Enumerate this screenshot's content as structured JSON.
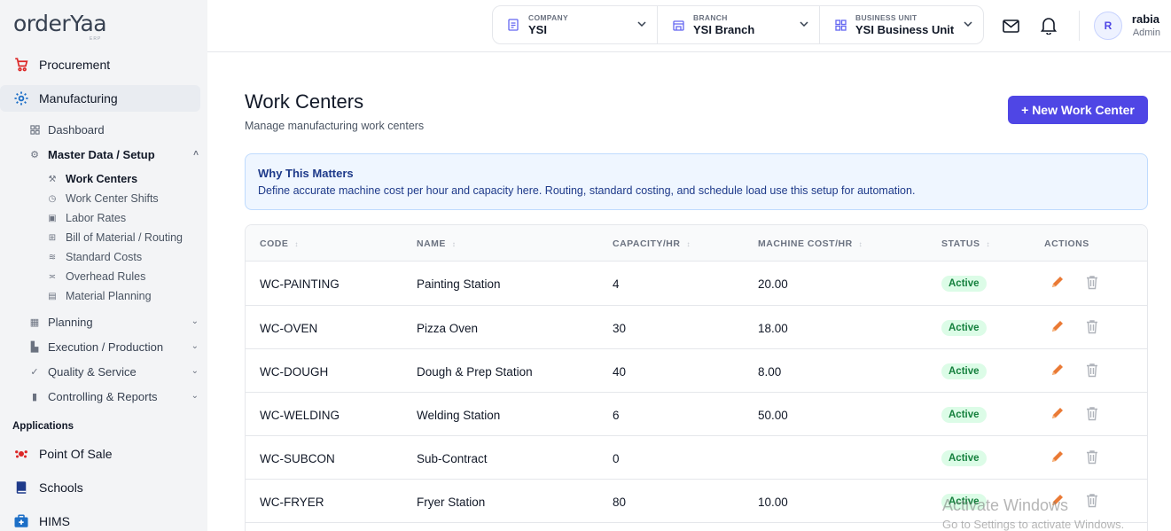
{
  "brand": {
    "logo": "orderYaa",
    "logo_sub": "ERP"
  },
  "sidebar": {
    "procurement": "Procurement",
    "manufacturing": "Manufacturing",
    "dashboard": "Dashboard",
    "master_data": "Master Data / Setup",
    "master_items": [
      "Work Centers",
      "Work Center Shifts",
      "Labor Rates",
      "Bill of Material / Routing",
      "Standard Costs",
      "Overhead Rules",
      "Material Planning"
    ],
    "groups": [
      "Planning",
      "Execution / Production",
      "Quality & Service",
      "Controlling & Reports"
    ],
    "applications_label": "Applications",
    "apps": [
      "Point Of Sale",
      "Schools",
      "HIMS"
    ]
  },
  "header": {
    "company": {
      "label": "COMPANY",
      "value": "YSI"
    },
    "branch": {
      "label": "BRANCH",
      "value": "YSI Branch"
    },
    "business_unit": {
      "label": "BUSINESS UNIT",
      "value": "YSI Business Unit"
    },
    "user": {
      "initial": "R",
      "name": "rabia",
      "role": "Admin"
    }
  },
  "page": {
    "title": "Work Centers",
    "subtitle": "Manage manufacturing work centers",
    "new_button": "+ New Work Center",
    "info_title": "Why This Matters",
    "info_text": "Define accurate machine cost per hour and capacity here. Routing, standard costing, and schedule load use this setup for automation."
  },
  "table": {
    "columns": [
      "CODE",
      "NAME",
      "CAPACITY/HR",
      "MACHINE COST/HR",
      "STATUS",
      "ACTIONS"
    ],
    "rows": [
      {
        "code": "WC-PAINTING",
        "name": "Painting Station",
        "capacity": "4",
        "cost": "20.00",
        "status": "Active"
      },
      {
        "code": "WC-OVEN",
        "name": "Pizza Oven",
        "capacity": "30",
        "cost": "18.00",
        "status": "Active"
      },
      {
        "code": "WC-DOUGH",
        "name": "Dough & Prep Station",
        "capacity": "40",
        "cost": "8.00",
        "status": "Active"
      },
      {
        "code": "WC-WELDING",
        "name": "Welding Station",
        "capacity": "6",
        "cost": "50.00",
        "status": "Active"
      },
      {
        "code": "WC-SUBCON",
        "name": "Sub-Contract",
        "capacity": "0",
        "cost": "",
        "status": "Active"
      },
      {
        "code": "WC-FRYER",
        "name": "Fryer Station",
        "capacity": "80",
        "cost": "10.00",
        "status": "Active"
      }
    ]
  },
  "watermark": {
    "line1": "Activate Windows",
    "line2": "Go to Settings to activate Windows."
  },
  "colors": {
    "primary": "#4f46e5",
    "active_badge_bg": "#dcfce7",
    "active_badge_text": "#15803d",
    "edit_icon": "#ea7a35",
    "delete_icon": "#b0b4bb",
    "procurement_icon": "#dc2626",
    "manufacturing_icon": "#1d6fc7"
  }
}
